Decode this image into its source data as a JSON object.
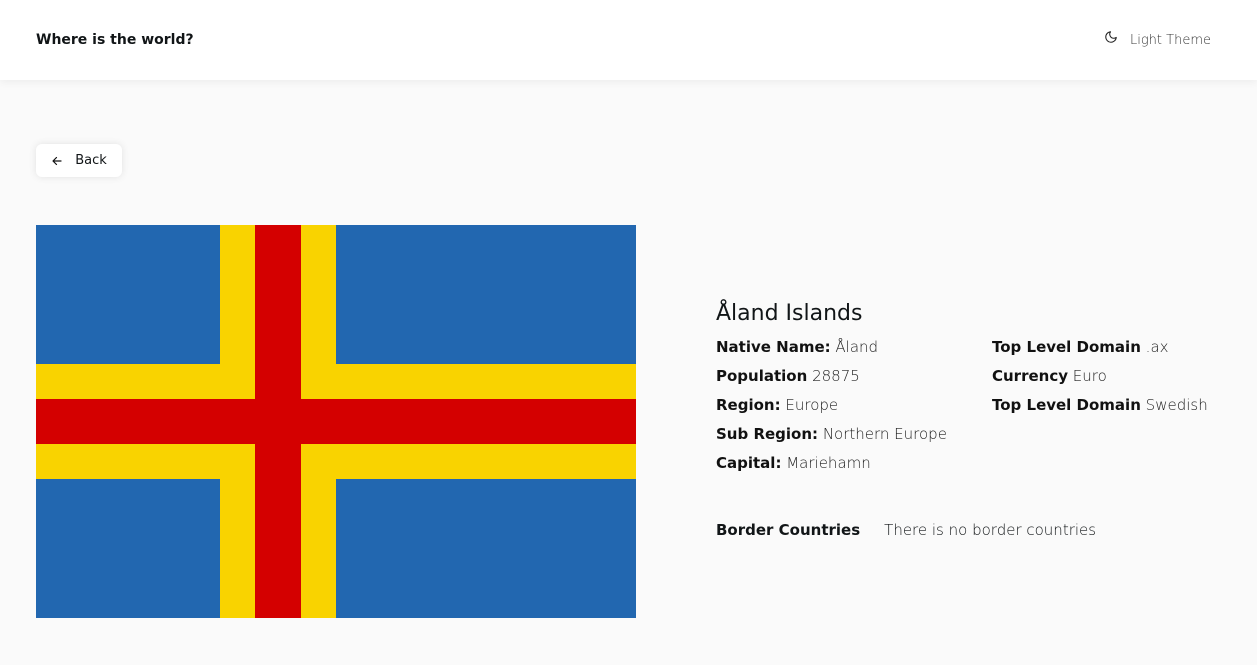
{
  "header": {
    "title": "Where is the world?",
    "theme_label": "Light Theme"
  },
  "back": {
    "label": "Back"
  },
  "country": {
    "name": "Åland Islands",
    "fields_left": [
      {
        "label": "Native Name:",
        "value": "Åland"
      },
      {
        "label": "Population",
        "value": "28875"
      },
      {
        "label": "Region:",
        "value": "Europe"
      },
      {
        "label": "Sub Region:",
        "value": "Northern Europe"
      },
      {
        "label": "Capital:",
        "value": "Mariehamn"
      }
    ],
    "fields_right": [
      {
        "label": "Top Level Domain",
        "value": ".ax"
      },
      {
        "label": "Currency",
        "value": "Euro"
      },
      {
        "label": "Top Level Domain",
        "value": "Swedish"
      }
    ],
    "border": {
      "label": "Border Countries",
      "value": "There is no border countries"
    }
  },
  "flag_colors": {
    "blue": "#2267b0",
    "yellow": "#f9d300",
    "red": "#d40000"
  }
}
